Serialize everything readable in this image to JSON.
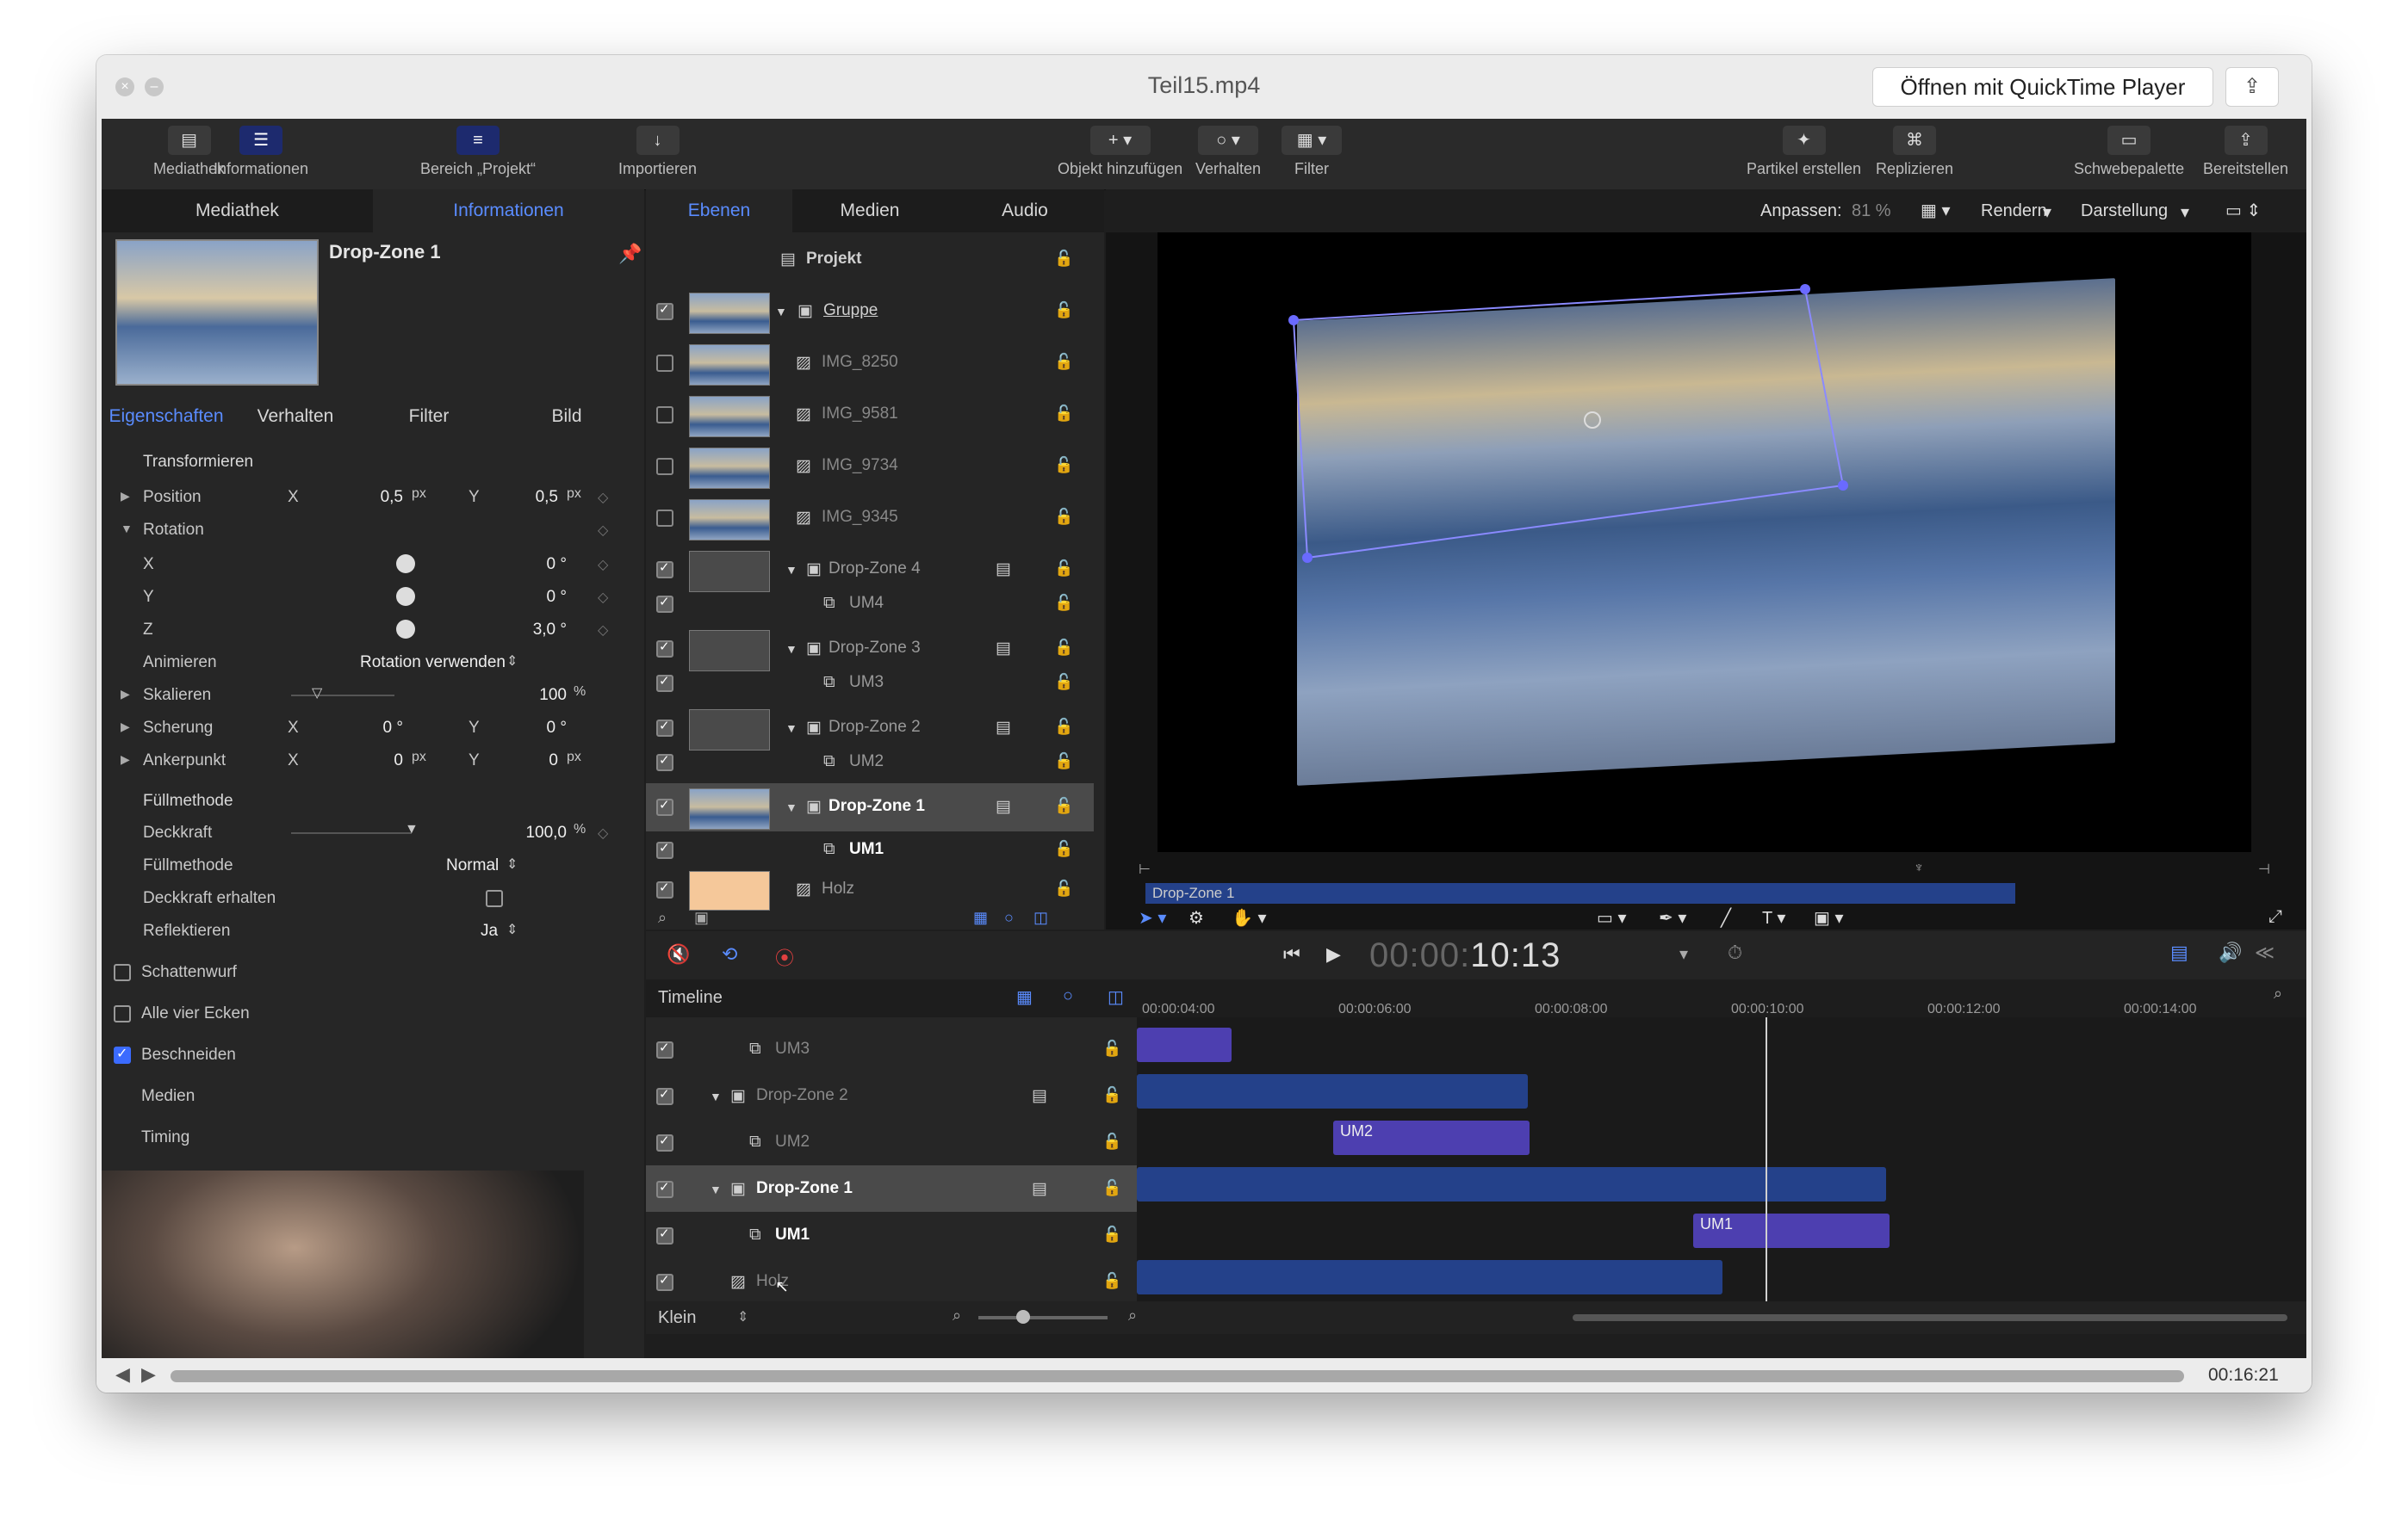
{
  "window": {
    "title": "Teil15.mp4",
    "open_with_label": "Öffnen mit QuickTime Player",
    "share_icon": "share-icon"
  },
  "toolbar": {
    "mediathek": "Mediathek",
    "informationen": "Informationen",
    "bereich": "Bereich „Projekt“",
    "importieren": "Importieren",
    "objekt_hinzufuegen": "Objekt hinzufügen",
    "verhalten": "Verhalten",
    "filter": "Filter",
    "partikel": "Partikel erstellen",
    "replizieren": "Replizieren",
    "schwebepalette": "Schwebepalette",
    "bereitstellen": "Bereitstellen"
  },
  "left_panel": {
    "tabs": [
      "Mediathek",
      "Informationen"
    ],
    "object_name": "Drop-Zone 1",
    "subtabs": [
      "Eigenschaften",
      "Verhalten",
      "Filter",
      "Bild"
    ],
    "transform_header": "Transformieren",
    "position": {
      "label": "Position",
      "x_label": "X",
      "x": "0,5",
      "x_unit": "px",
      "y_label": "Y",
      "y": "0,5",
      "y_unit": "px"
    },
    "rotation": {
      "label": "Rotation",
      "x_label": "X",
      "x": "0 °",
      "y_label": "Y",
      "y": "0 °",
      "z_label": "Z",
      "z": "3,0 °"
    },
    "animieren": {
      "label": "Animieren",
      "value": "Rotation verwenden"
    },
    "skalieren": {
      "label": "Skalieren",
      "value": "100",
      "unit": "%"
    },
    "scherung": {
      "label": "Scherung",
      "x_label": "X",
      "x": "0 °",
      "y_label": "Y",
      "y": "0 °"
    },
    "ankerpunkt": {
      "label": "Ankerpunkt",
      "x_label": "X",
      "x": "0",
      "x_unit": "px",
      "y_label": "Y",
      "y": "0",
      "y_unit": "px"
    },
    "fuellmethode_header": "Füllmethode",
    "deckkraft": {
      "label": "Deckkraft",
      "value": "100,0",
      "unit": "%"
    },
    "fuellmethode": {
      "label": "Füllmethode",
      "value": "Normal"
    },
    "deckkraft_erhalten": "Deckkraft erhalten",
    "reflektieren": {
      "label": "Reflektieren",
      "value": "Ja"
    },
    "schattenwurf": "Schattenwurf",
    "alle_vier_ecken": "Alle vier Ecken",
    "beschneiden": "Beschneiden",
    "medien": "Medien",
    "timing": "Timing"
  },
  "layers_panel": {
    "tabs": [
      "Ebenen",
      "Medien",
      "Audio"
    ],
    "project": "Projekt",
    "group": "Gruppe",
    "items": [
      "IMG_8250",
      "IMG_9581",
      "IMG_9734",
      "IMG_9345"
    ],
    "drop_zones": [
      {
        "name": "Drop-Zone 4",
        "child": "UM4"
      },
      {
        "name": "Drop-Zone 3",
        "child": "UM3"
      },
      {
        "name": "Drop-Zone 2",
        "child": "UM2"
      },
      {
        "name": "Drop-Zone 1",
        "child": "UM1"
      }
    ],
    "holz": "Holz"
  },
  "canvas": {
    "fit_label": "Anpassen:",
    "fit_value": "81 %",
    "render": "Rendern",
    "darstellung": "Darstellung",
    "mini_timeline_label": "Drop-Zone 1"
  },
  "transport": {
    "timecode_dim": "00:00:",
    "timecode": "10:13"
  },
  "timeline": {
    "label": "Timeline",
    "ticks": [
      "00:00:04:00",
      "00:00:06:00",
      "00:00:08:00",
      "00:00:10:00",
      "00:00:12:00",
      "00:00:14:00"
    ],
    "rows": [
      "UM3",
      "Drop-Zone 2",
      "UM2",
      "Drop-Zone 1",
      "UM1",
      "Holz"
    ],
    "bar_um2": "UM2",
    "bar_um1": "UM1",
    "size_label": "Klein"
  },
  "qt": {
    "time": "00:16:21"
  },
  "colors": {
    "accent": "#5a8cff",
    "clip_blue": "#24418a",
    "clip_purple": "#4d3fb0"
  }
}
